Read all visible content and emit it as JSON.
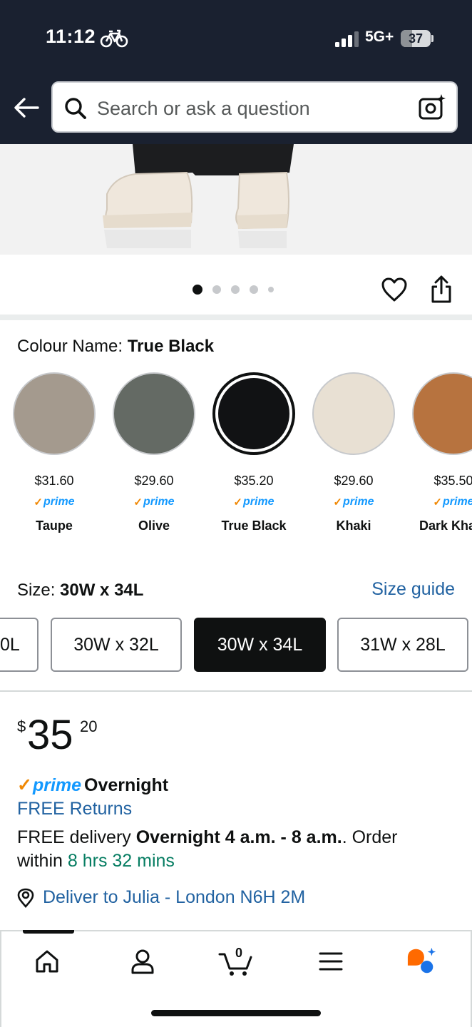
{
  "status_bar": {
    "time": "11:12",
    "network": "5G+",
    "battery": "37",
    "battery_level": 0.37
  },
  "search": {
    "placeholder": "Search or ask a question"
  },
  "gallery": {
    "image_count": 5,
    "active_index": 0
  },
  "colour": {
    "label": "Colour Name:",
    "selected": "True Black",
    "options": [
      {
        "name": "Taupe",
        "price": "$31.60",
        "prime": "prime",
        "color": "#a49a8e"
      },
      {
        "name": "Olive",
        "price": "$29.60",
        "prime": "prime",
        "color": "#646a64"
      },
      {
        "name": "True Black",
        "price": "$35.20",
        "prime": "prime",
        "color": "#111214"
      },
      {
        "name": "Khaki",
        "price": "$29.60",
        "prime": "prime",
        "color": "#e8e0d3"
      },
      {
        "name": "Dark Kha",
        "price": "$35.50",
        "prime": "prime",
        "color": "#b7733f"
      }
    ]
  },
  "size": {
    "label": "Size:",
    "selected": "30W x 34L",
    "guide_link": "Size guide",
    "options": [
      "0L",
      "30W x 32L",
      "30W x 34L",
      "31W x 28L"
    ]
  },
  "price": {
    "symbol": "$",
    "whole": "35",
    "fraction": "20"
  },
  "delivery": {
    "prime_logo": "prime",
    "prime_speed": "Overnight",
    "free_returns": "FREE Returns",
    "text_prefix": "FREE delivery ",
    "window": "Overnight 4 a.m. - 8 a.m.",
    "text_mid": ". Order within ",
    "countdown": "8 hrs 32 mins",
    "deliver_to": "Deliver to Julia - London N6H 2M"
  },
  "nav": {
    "cart_count": "0",
    "items": [
      "home-icon",
      "account-icon",
      "cart-icon",
      "menu-icon",
      "rufus-icon"
    ]
  },
  "colors": {
    "topbar": "#1a2130",
    "link": "#2162a1",
    "prime_blue": "#1399ff",
    "prime_check": "#f08804",
    "countdown_green": "#067d62"
  }
}
